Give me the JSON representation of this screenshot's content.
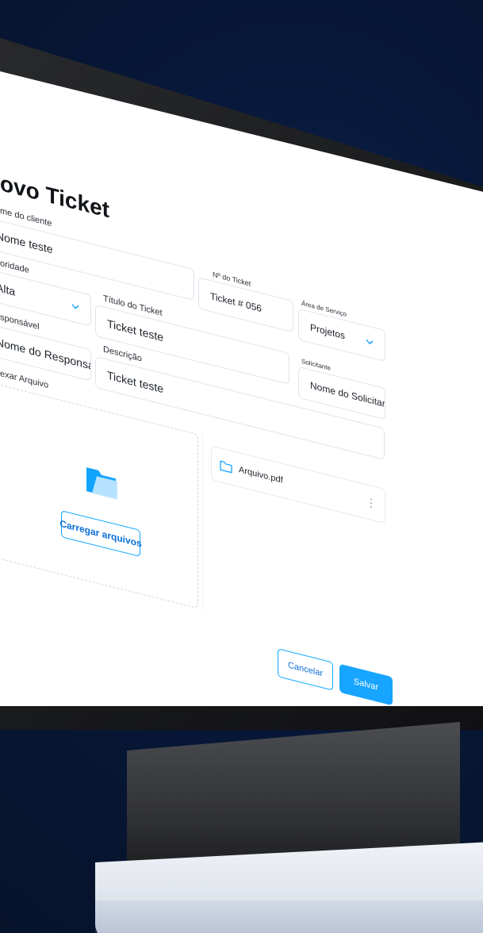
{
  "form": {
    "title": "ovo Ticket",
    "fields": {
      "client_name": {
        "label": "me do cliente",
        "value": "Nome teste"
      },
      "priority": {
        "label": "oridade",
        "value": "Alta"
      },
      "responsible": {
        "label": "sponsável",
        "value": "Nome do Responsável"
      },
      "ticket_number": {
        "label": "Nº do Ticket",
        "value": "Ticket # 056"
      },
      "service_area": {
        "label": "Área de Serviço",
        "value": "Projetos"
      },
      "ticket_title": {
        "label": "Título do Ticket",
        "value": "Ticket teste"
      },
      "requester": {
        "label": "Solicitante",
        "value": "Nome do Solicitante"
      },
      "description": {
        "label": "Descrição",
        "value": "Ticket teste"
      }
    },
    "attach": {
      "label": "exar Arquivo",
      "upload_button": "Carregar arquivos"
    },
    "files": [
      {
        "name": "Arquivo.pdf"
      }
    ],
    "actions": {
      "cancel_label": "Cancelar",
      "save_label": "Salvar"
    },
    "icons": {
      "folder": "folder-icon",
      "chevron": "chevron-down-icon",
      "file": "folder-outline-icon",
      "more": "kebab-icon"
    },
    "colors": {
      "accent": "#18a5ff",
      "accent_text": "#0b6fd6",
      "folder_fill": "#12a3ff"
    }
  }
}
